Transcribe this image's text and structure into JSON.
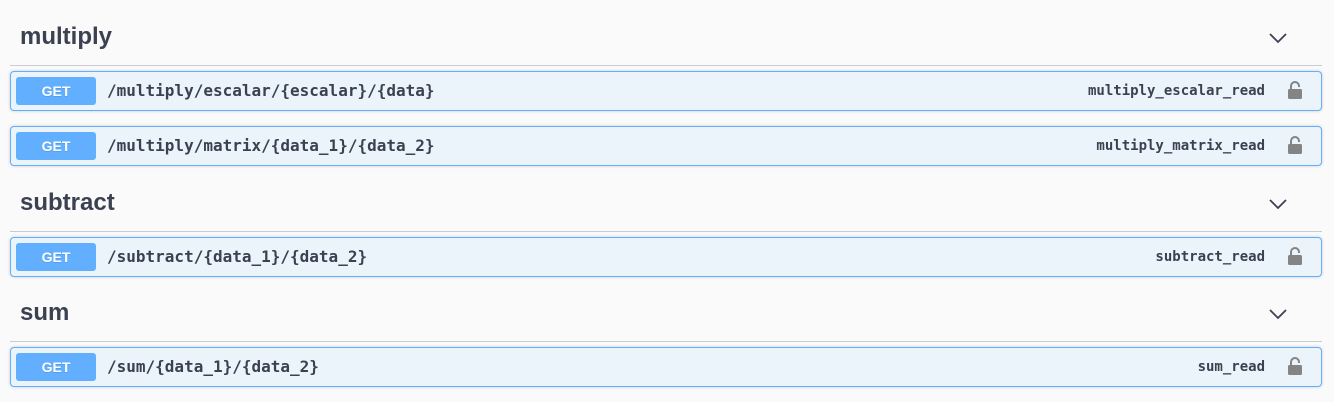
{
  "sections": [
    {
      "title": "multiply",
      "chevron_icon": "chevron-down-icon",
      "operations": [
        {
          "method": "GET",
          "path": "/multiply/escalar/{escalar}/{data}",
          "operation_id": "multiply_escalar_read",
          "lock_icon": "lock-icon"
        },
        {
          "method": "GET",
          "path": "/multiply/matrix/{data_1}/{data_2}",
          "operation_id": "multiply_matrix_read",
          "lock_icon": "lock-icon"
        }
      ]
    },
    {
      "title": "subtract",
      "chevron_icon": "chevron-down-icon",
      "operations": [
        {
          "method": "GET",
          "path": "/subtract/{data_1}/{data_2}",
          "operation_id": "subtract_read",
          "lock_icon": "lock-icon"
        }
      ]
    },
    {
      "title": "sum",
      "chevron_icon": "chevron-down-icon",
      "operations": [
        {
          "method": "GET",
          "path": "/sum/{data_1}/{data_2}",
          "operation_id": "sum_read",
          "lock_icon": "lock-icon"
        }
      ]
    }
  ],
  "colors": {
    "get_accent": "#61affe",
    "get_background": "#ebf3fb",
    "text": "#3b4151",
    "icon": "#848484"
  }
}
